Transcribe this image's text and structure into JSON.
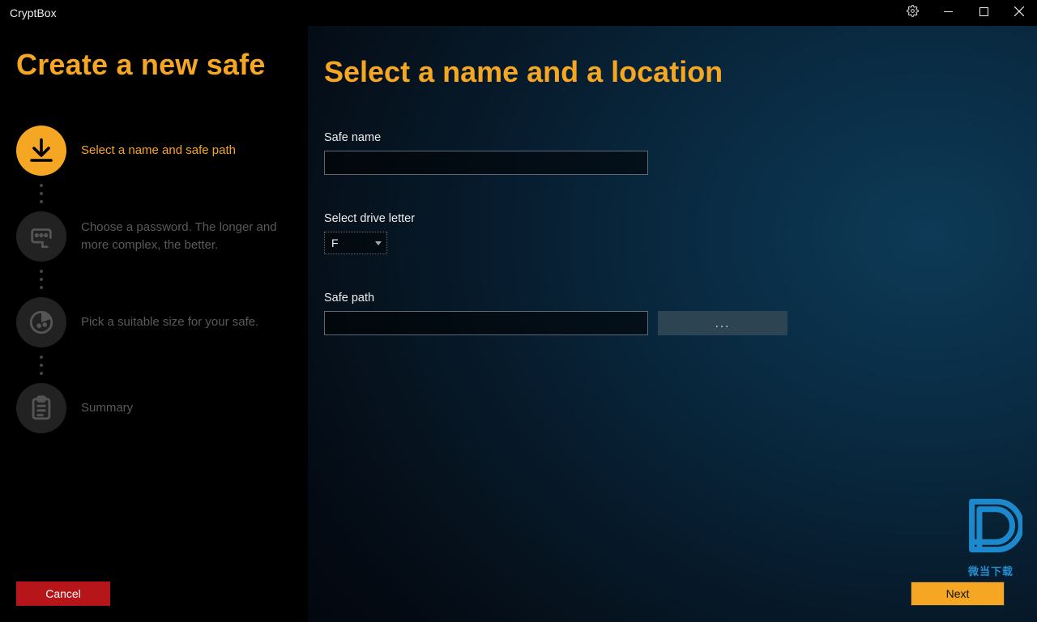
{
  "app": {
    "name": "CryptBox"
  },
  "sidebar": {
    "title": "Create a new safe",
    "steps": {
      "s1": "Select a name and safe path",
      "s2": "Choose a password. The longer and more complex, the better.",
      "s3": "Pick a suitable size for your safe.",
      "s4": "Summary"
    },
    "cancel": "Cancel"
  },
  "content": {
    "title": "Select a name and a location",
    "safe_name_label": "Safe name",
    "safe_name_value": "",
    "drive_label": "Select drive letter",
    "drive_value": "F",
    "path_label": "Safe path",
    "path_value": "",
    "browse_label": "...",
    "next": "Next"
  },
  "watermark": {
    "caption": "微当下载"
  },
  "colors": {
    "accent": "#f5a623",
    "danger": "#b6161a"
  }
}
